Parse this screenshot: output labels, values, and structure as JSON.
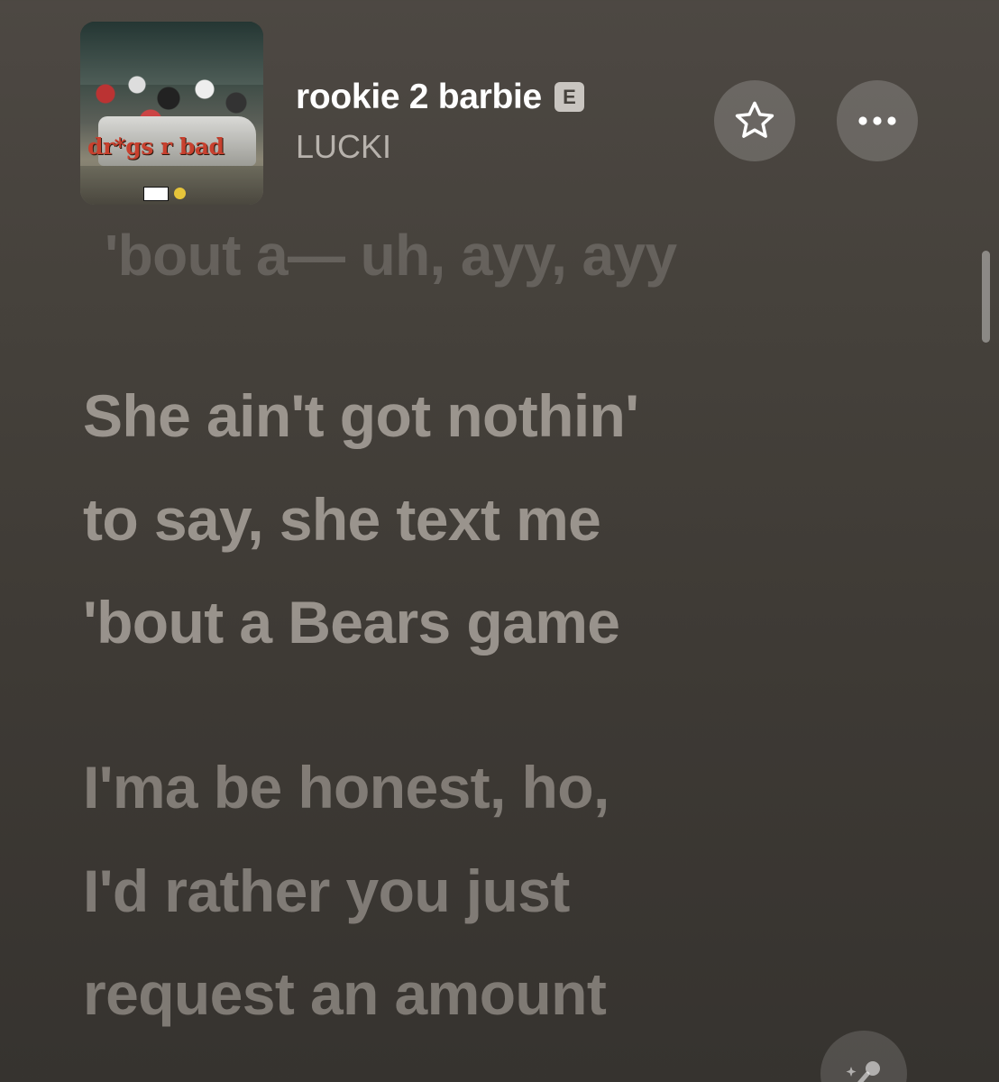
{
  "now_playing": {
    "album_art_text": "dr*gs r bad",
    "track_title": "rookie 2 barbie",
    "explicit_badge": "E",
    "artist": "LUCKI"
  },
  "actions": {
    "favorite_icon": "star-icon",
    "more_icon": "ellipsis-icon"
  },
  "lyrics": {
    "previous_line": "'bout a— uh, ayy, ayy",
    "current": [
      "She ain't got nothin'",
      "to say, she text me",
      "'bout a Bears game"
    ],
    "next": [
      "I'ma be honest, ho,",
      "I'd rather you just",
      "request an amount"
    ]
  },
  "footer": {
    "lyrics_mic_icon": "microphone-sparkle-icon"
  },
  "colors": {
    "background": "#45413b",
    "title": "#ffffff",
    "artist": "#b7b2ac",
    "badge": "#c9c5c0"
  }
}
